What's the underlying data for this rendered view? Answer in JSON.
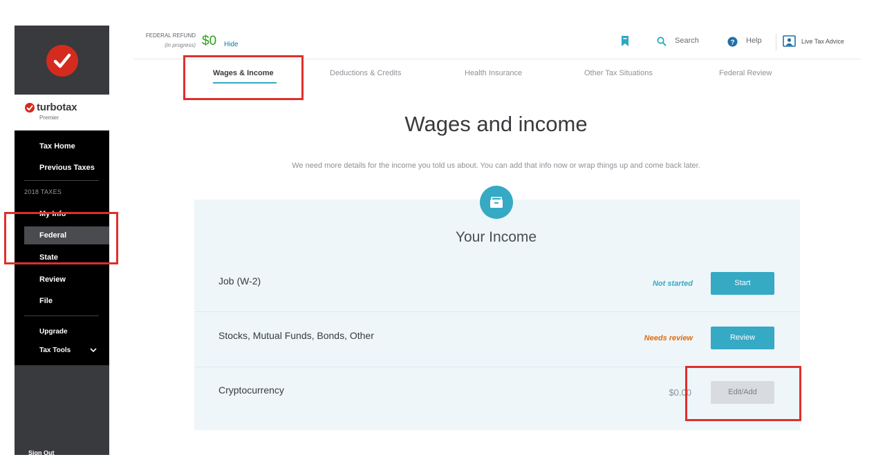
{
  "sidebar": {
    "brand_name": "turbotax",
    "brand_edition": "Premier",
    "nav": {
      "tax_home": "Tax Home",
      "previous_taxes": "Previous Taxes",
      "section_label": "2018 TAXES",
      "my_info": "My Info",
      "federal": "Federal",
      "state": "State",
      "review": "Review",
      "file": "File",
      "upgrade": "Upgrade",
      "tax_tools": "Tax Tools"
    },
    "sign_out": "Sign Out"
  },
  "header": {
    "refund_label": "FEDERAL REFUND",
    "refund_status": "(in progress)",
    "refund_amount": "$0",
    "hide_label": "Hide",
    "search_label": "Search",
    "help_label": "Help",
    "live_advice_label": "Live Tax Advice"
  },
  "tabs": [
    {
      "label": "Wages & Income"
    },
    {
      "label": "Deductions & Credits"
    },
    {
      "label": "Health Insurance"
    },
    {
      "label": "Other Tax Situations"
    },
    {
      "label": "Federal Review"
    }
  ],
  "main": {
    "title": "Wages and income",
    "description": "We need more details for the income you told us about. You can add that info now or wrap things up and come back later.",
    "card_title": "Your Income",
    "rows": [
      {
        "label": "Job (W-2)",
        "status": "Not started",
        "button": "Start"
      },
      {
        "label": "Stocks, Mutual Funds, Bonds, Other",
        "status": "Needs review",
        "button": "Review"
      },
      {
        "label": "Cryptocurrency",
        "amount": "$0.00",
        "button": "Edit/Add"
      }
    ]
  },
  "colors": {
    "accent": "#36a9c4",
    "brand_red": "#d52b1e",
    "refund_green": "#2ca01c",
    "status_not_started": "#36a9c4",
    "status_needs_review": "#e06a0e",
    "highlight_box": "#e02e2a"
  },
  "icons": [
    "checkmark-logo-icon",
    "bookmark-icon",
    "search-icon",
    "help-icon",
    "live-advice-icon",
    "chevron-down-icon",
    "income-box-icon"
  ]
}
